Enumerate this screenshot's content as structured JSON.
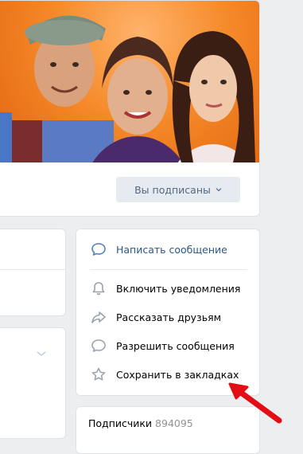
{
  "header": {
    "subscribe_button": "Вы подписаны"
  },
  "actions": [
    {
      "label": "Написать сообщение",
      "icon": "message-bubble-icon"
    },
    {
      "label": "Включить уведомления",
      "icon": "bell-icon"
    },
    {
      "label": "Рассказать друзьям",
      "icon": "share-arrow-icon"
    },
    {
      "label": "Разрешить сообщения",
      "icon": "message-bubble-icon"
    },
    {
      "label": "Сохранить в закладках",
      "icon": "star-icon"
    }
  ],
  "followers": {
    "label": "Подписчики",
    "count": "894095"
  },
  "colors": {
    "link": "#2a5885",
    "button_bg": "#e5ebf1",
    "button_text": "#55677d",
    "page_bg": "#edeef0",
    "icon": "#99a2ad",
    "accent_icon": "#5181b8",
    "arrow": "#e30d16"
  }
}
